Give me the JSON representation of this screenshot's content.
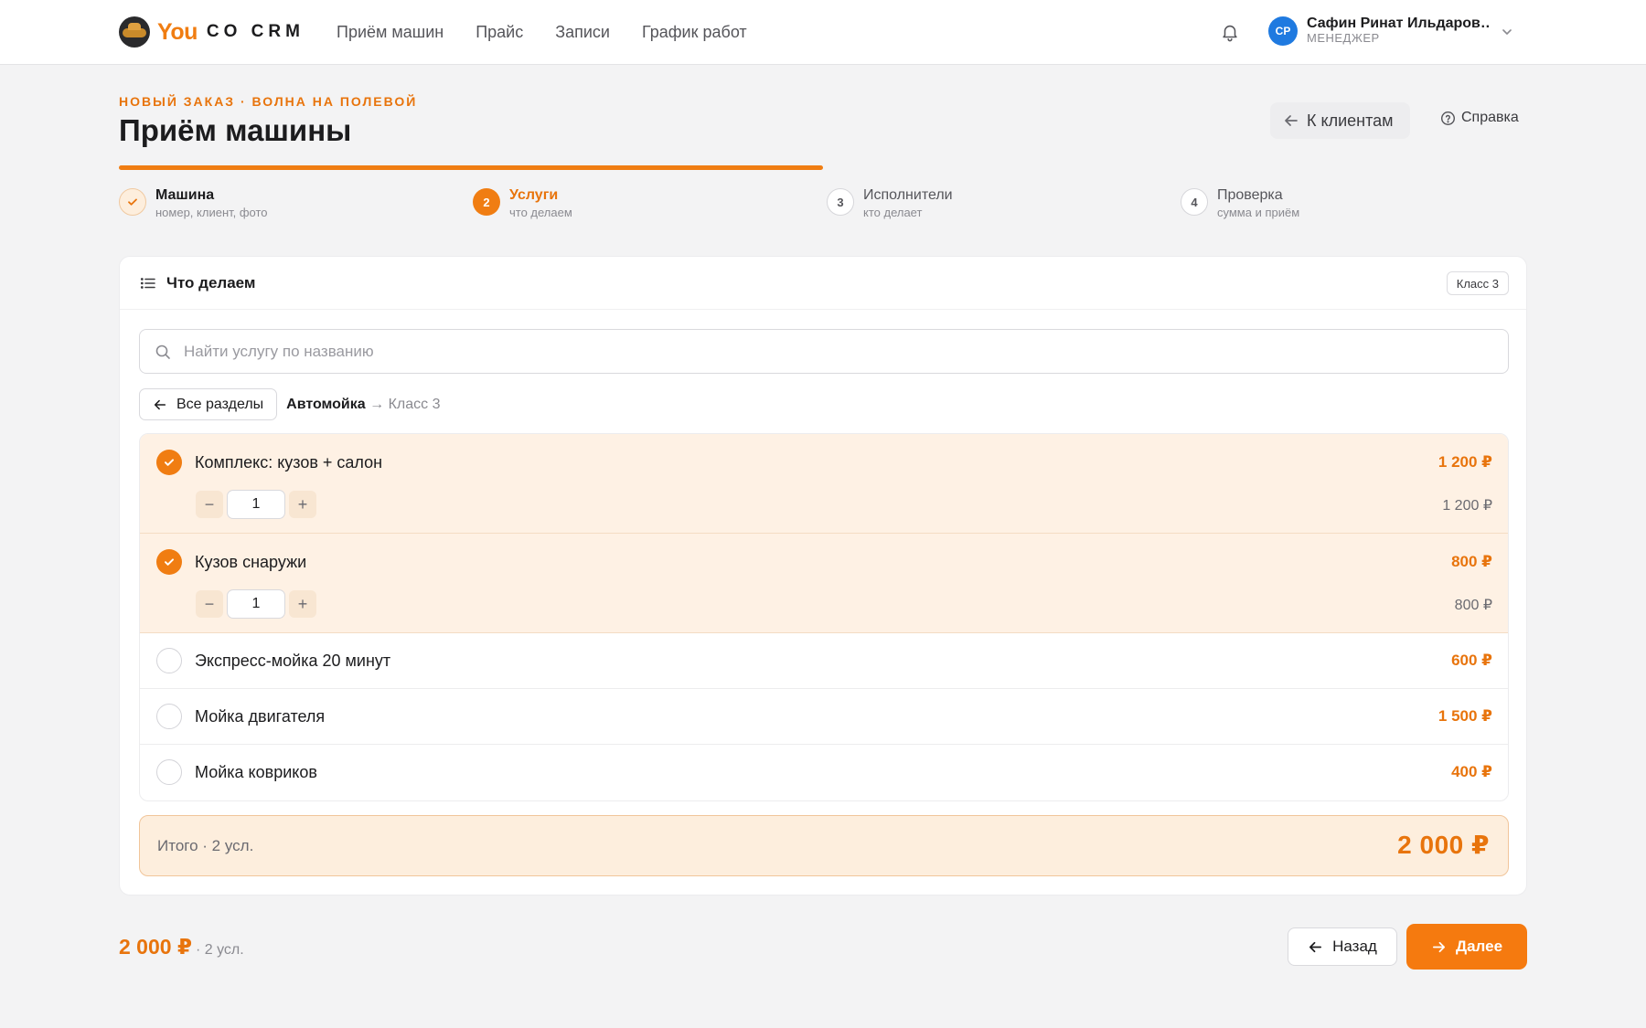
{
  "brand": {
    "you": "You",
    "rest": "CO CRM"
  },
  "nav": {
    "items": [
      {
        "label": "Приём машин"
      },
      {
        "label": "Прайс"
      },
      {
        "label": "Записи"
      },
      {
        "label": "График работ"
      }
    ]
  },
  "user": {
    "initials": "СР",
    "name": "Сафин Ринат Ильдаров…",
    "role": "МЕНЕДЖЕР"
  },
  "header": {
    "eyebrow": "НОВЫЙ ЗАКАЗ · ВОЛНА НА ПОЛЕВОЙ",
    "title": "Приём машины",
    "to_clients": "К клиентам",
    "help": "Справка"
  },
  "stepper": {
    "progress": 0.5,
    "steps": [
      {
        "number": "1",
        "title": "Машина",
        "subtitle": "номер, клиент, фото",
        "state": "done"
      },
      {
        "number": "2",
        "title": "Услуги",
        "subtitle": "что делаем",
        "state": "active"
      },
      {
        "number": "3",
        "title": "Исполнители",
        "subtitle": "кто делает",
        "state": "todo"
      },
      {
        "number": "4",
        "title": "Проверка",
        "subtitle": "сумма и приём",
        "state": "todo"
      }
    ]
  },
  "services": {
    "title": "Что делаем",
    "class_badge": "Класс 3",
    "search_placeholder": "Найти услугу по названию",
    "all_sections": "Все разделы",
    "crumb_section": "Автомойка",
    "crumb_rest": " → Класс 3",
    "items": [
      {
        "name": "Комплекс: кузов + салон",
        "price": "1 200 ₽",
        "selected": true,
        "qty": "1",
        "line_total": "1 200 ₽"
      },
      {
        "name": "Кузов снаружи",
        "price": "800 ₽",
        "selected": true,
        "qty": "1",
        "line_total": "800 ₽"
      },
      {
        "name": "Экспресс-мойка 20 минут",
        "price": "600 ₽",
        "selected": false
      },
      {
        "name": "Мойка двигателя",
        "price": "1 500 ₽",
        "selected": false
      },
      {
        "name": "Мойка ковриков",
        "price": "400 ₽",
        "selected": false
      }
    ],
    "total_label": "Итого · 2 усл.",
    "total_sum": "2 000 ₽"
  },
  "footer": {
    "amount": "2 000 ₽",
    "count": "· 2 усл.",
    "back": "Назад",
    "next": "Далее"
  },
  "colors": {
    "accent": "#f07d12",
    "accent_text": "#e8740c",
    "selected_bg": "#fef1e4",
    "avatar": "#1f7ae0"
  }
}
